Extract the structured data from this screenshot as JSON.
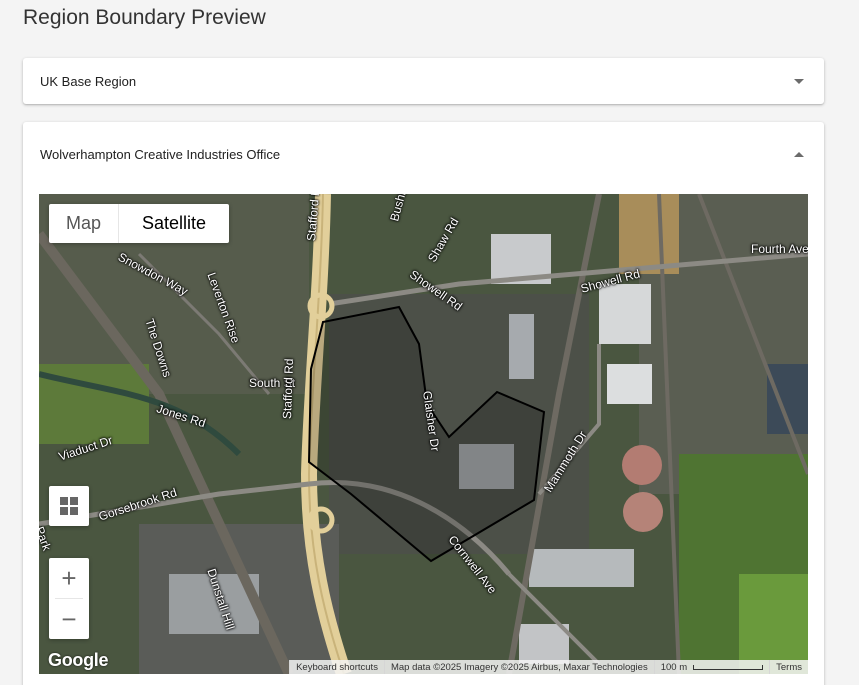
{
  "page": {
    "title": "Region Boundary Preview"
  },
  "panels": [
    {
      "title": "UK Base Region",
      "expanded": false
    },
    {
      "title": "Wolverhampton Creative Industries Office",
      "expanded": true
    }
  ],
  "map": {
    "type_control": {
      "map_label": "Map",
      "satellite_label": "Satellite",
      "selected": "Satellite"
    },
    "controls": {
      "layers_icon": "grid-icon",
      "zoom_in": "+",
      "zoom_out": "−"
    },
    "logo": "Google",
    "attribution": {
      "shortcuts": "Keyboard shortcuts",
      "data": "Map data ©2025 Imagery ©2025 Airbus, Maxar Technologies",
      "scale": "100 m",
      "terms": "Terms"
    },
    "streets": [
      "Stafford Rd",
      "Bushbury",
      "Shaw Rd",
      "Showell Rd",
      "Showell Rd",
      "Fourth Ave",
      "Snowdon Way",
      "Leverton Rise",
      "The Downs",
      "South St",
      "Jones Rd",
      "Viaduct Dr",
      "Gorsebrook Rd",
      "Glaisher Dr",
      "Mammoth Dr",
      "Cornwell Ave",
      "Dunstall Hill",
      "Park",
      "Stafford Rd"
    ],
    "boundary_color": "#000000"
  }
}
